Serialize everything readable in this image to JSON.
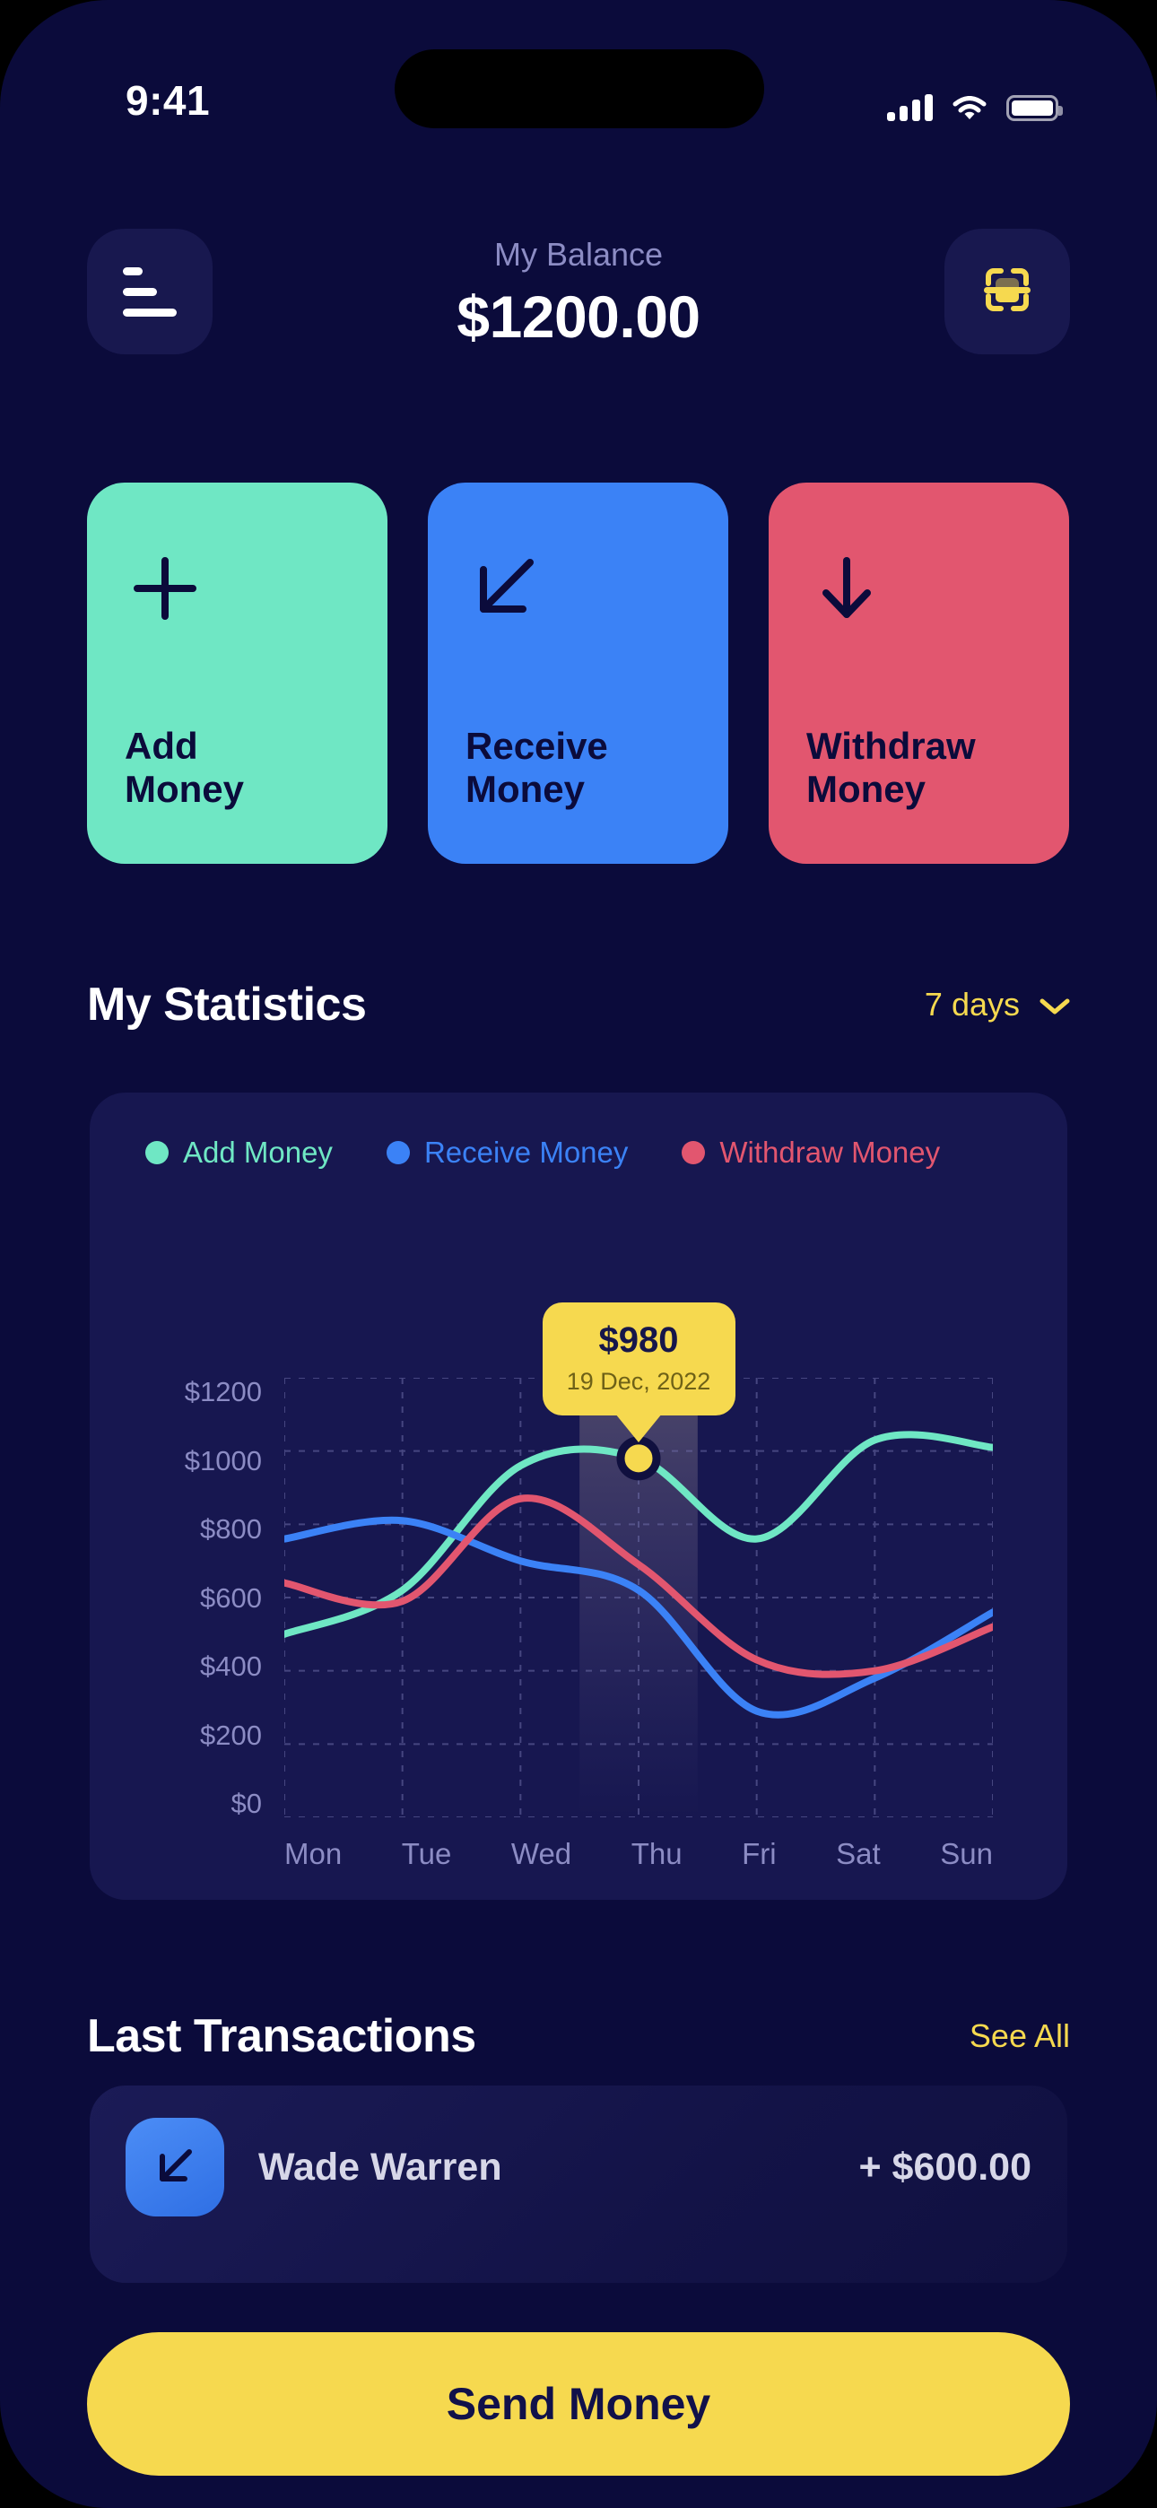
{
  "status_bar": {
    "time": "9:41",
    "cellular_icon": "signal-bars-icon",
    "wifi_icon": "wifi-icon",
    "battery_icon": "battery-icon"
  },
  "header": {
    "menu_icon": "menu-icon",
    "scan_icon": "scan-icon",
    "balance_label": "My Balance",
    "balance_value": "$1200.00"
  },
  "actions": [
    {
      "id": "add-money",
      "label": "Add\nMoney",
      "icon": "plus-icon",
      "color": "#6FE7C4",
      "text_color": "#0B0B3B"
    },
    {
      "id": "receive-money",
      "label": "Receive\nMoney",
      "icon": "arrow-down-left-icon",
      "color": "#3B82F6",
      "text_color": "#0B0B3B"
    },
    {
      "id": "withdraw-money",
      "label": "Withdraw\nMoney",
      "icon": "arrow-down-icon",
      "color": "#E2566F",
      "text_color": "#0B0B3B"
    }
  ],
  "statistics": {
    "title": "My Statistics",
    "range_label": "7 days",
    "range_icon": "chevron-down-icon"
  },
  "chart_data": {
    "type": "line",
    "title": "My Statistics",
    "xlabel": "",
    "ylabel": "",
    "categories": [
      "Mon",
      "Tue",
      "Wed",
      "Thu",
      "Fri",
      "Sat",
      "Sun"
    ],
    "x_tick_labels": [
      "Mon",
      "Tue",
      "Wed",
      "Thu",
      "Fri",
      "Sat",
      "Sun"
    ],
    "y_tick_labels": [
      "$1200",
      "$1000",
      "$800",
      "$600",
      "$400",
      "$200",
      "$0"
    ],
    "ylim": [
      0,
      1200
    ],
    "y_tick_step": 200,
    "grid": true,
    "grid_style": "dashed",
    "legend_position": "top-left",
    "series": [
      {
        "name": "Add Money",
        "color": "#6FE7C4",
        "values": [
          500,
          620,
          960,
          980,
          760,
          1030,
          1010
        ]
      },
      {
        "name": "Receive Money",
        "color": "#3B82F6",
        "values": [
          760,
          810,
          700,
          620,
          290,
          380,
          560
        ]
      },
      {
        "name": "Withdraw Money",
        "color": "#E2566F",
        "values": [
          640,
          590,
          870,
          690,
          430,
          400,
          520
        ]
      }
    ],
    "highlight": {
      "category": "Thu",
      "series": "Add Money",
      "value": 980,
      "value_label": "$980",
      "date_label": "19 Dec, 2022",
      "marker_color": "#F6D94F"
    }
  },
  "legend": [
    {
      "label": "Add Money",
      "color": "#6FE7C4"
    },
    {
      "label": "Receive Money",
      "color": "#3B82F6"
    },
    {
      "label": "Withdraw Money",
      "color": "#E2566F"
    }
  ],
  "tooltip": {
    "value": "$980",
    "date": "19 Dec, 2022"
  },
  "transactions": {
    "title": "Last Transactions",
    "see_all_label": "See All",
    "items": [
      {
        "name": "Wade Warren",
        "amount": "+ $600.00",
        "icon": "arrow-down-left-icon"
      }
    ]
  },
  "cta": {
    "label": "Send Money"
  },
  "theme": {
    "background": "#0B0B3B",
    "card": "#171750",
    "accent_yellow": "#F6D94F",
    "muted_text": "#8C8CC4"
  }
}
